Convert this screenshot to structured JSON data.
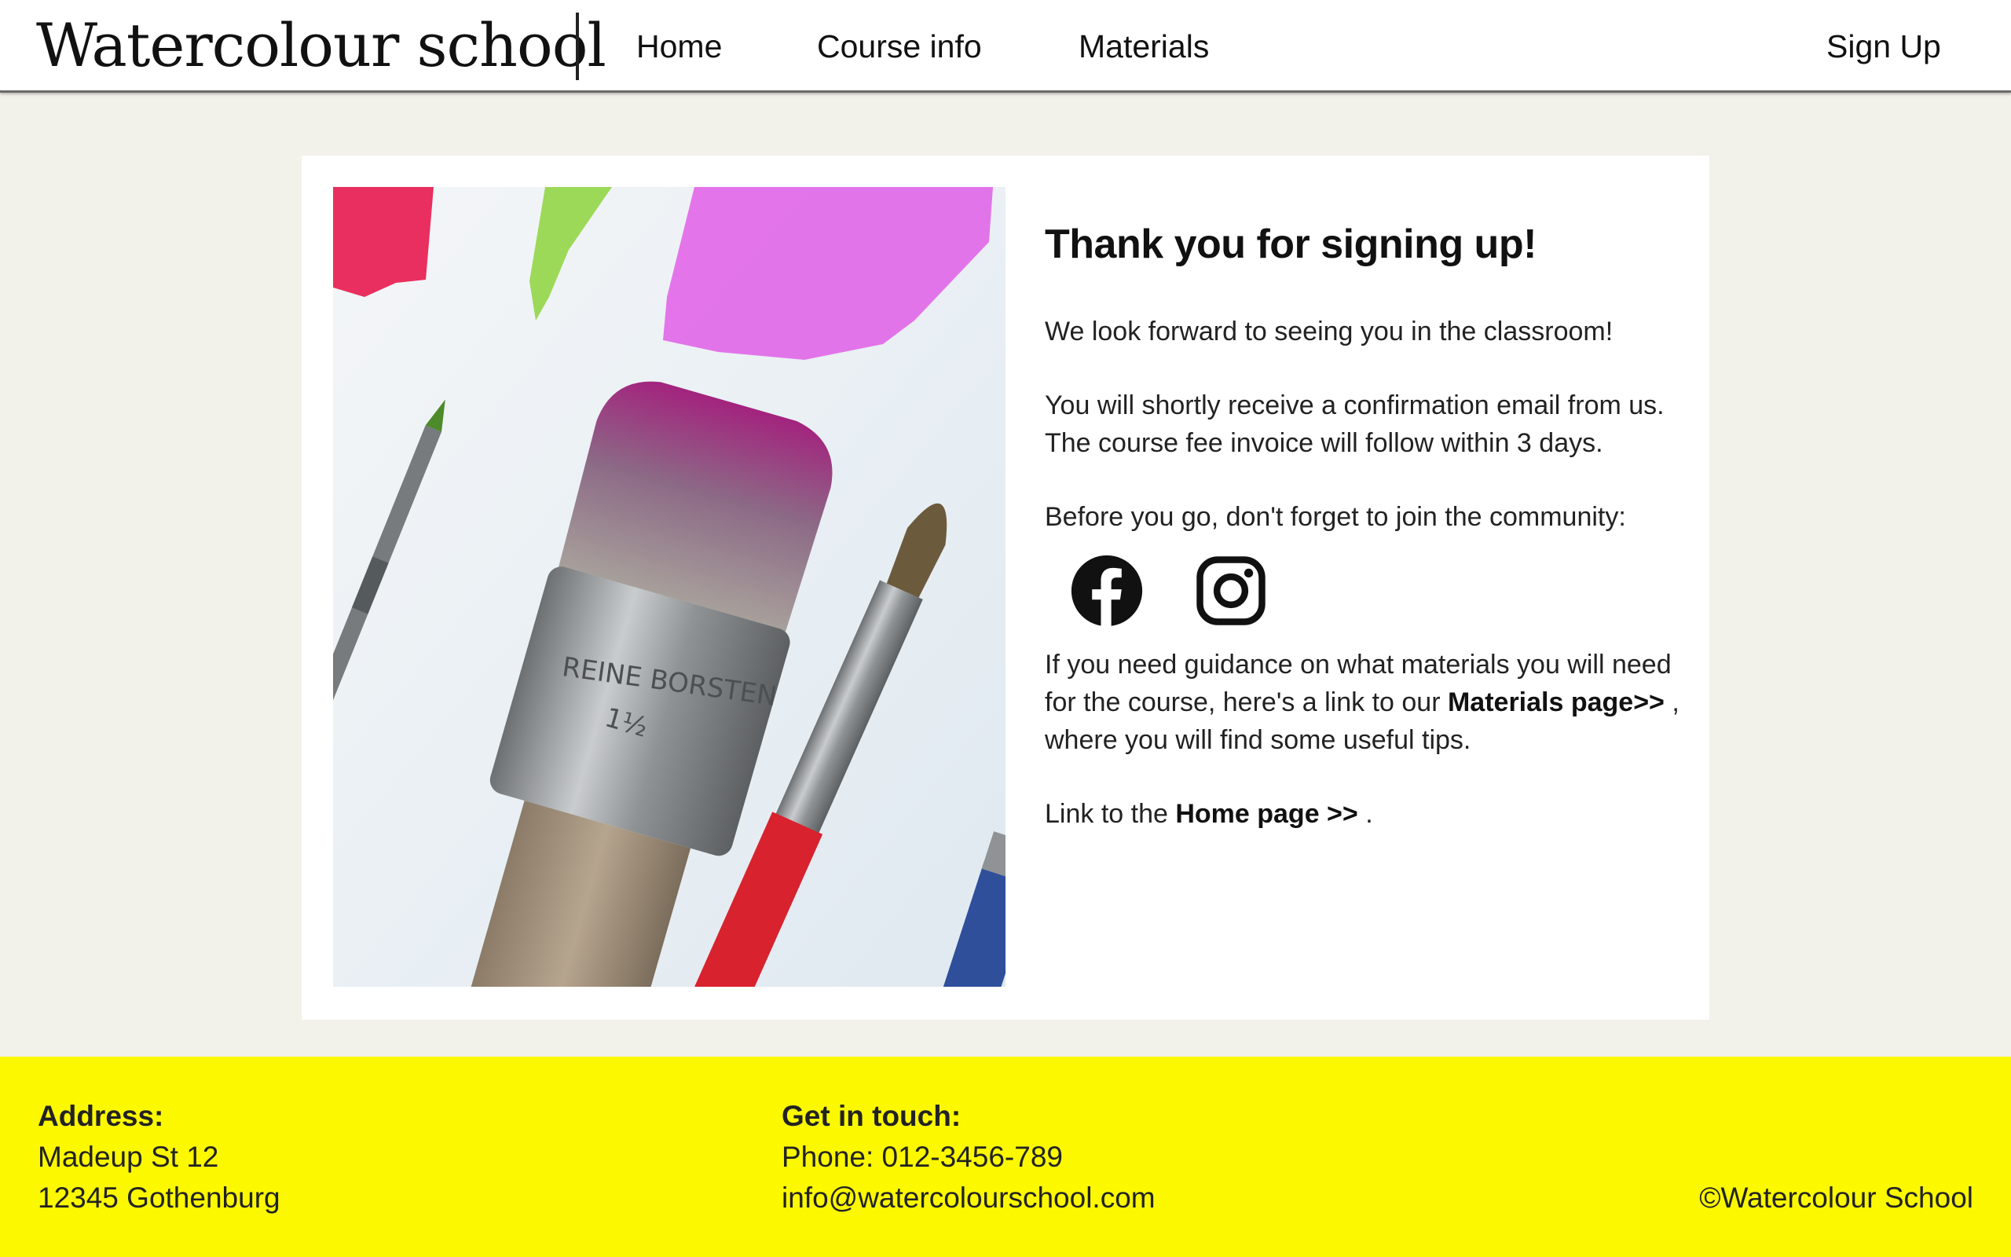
{
  "header": {
    "logo": "Watercolour school",
    "nav": {
      "home": "Home",
      "course_info": "Course info",
      "materials": "Materials"
    },
    "signup": "Sign Up"
  },
  "main": {
    "title": "Thank you for signing up!",
    "p1": "We look forward to seeing you in the classroom!",
    "p2": "You will shortly receive a confirmation email from us. The course fee invoice will follow within 3 days.",
    "p3": "Before you go, don't forget to join the community:",
    "social": [
      "facebook-icon",
      "instagram-icon"
    ],
    "p4_before": "If you need guidance on what materials you will need for the course, here's a link to our ",
    "p4_link": "Materials page>>",
    "p4_after": " , where you will find some useful tips.",
    "p5_before": "Link to the ",
    "p5_link": "Home page >>",
    "p5_after": " ."
  },
  "footer": {
    "address_heading": "Address:",
    "address_line1": "Madeup St 12",
    "address_line2": "12345 Gothenburg",
    "contact_heading": "Get in touch:",
    "phone": "Phone: 012-3456-789",
    "email": "info@watercolourschool.com",
    "copyright": "©Watercolour School"
  },
  "colors": {
    "footer_bg": "#fbf800",
    "page_bg": "#f2f1ea",
    "card_bg": "#ffffff"
  }
}
